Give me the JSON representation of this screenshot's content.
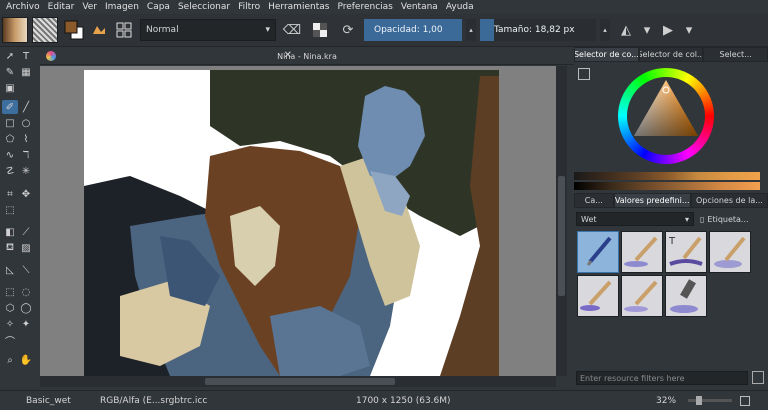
{
  "menu": [
    "Archivo",
    "Editar",
    "Ver",
    "Imagen",
    "Capa",
    "Seleccionar",
    "Filtro",
    "Herramientas",
    "Preferencias",
    "Ventana",
    "Ayuda"
  ],
  "toolbar": {
    "blend_mode": "Normal",
    "opacity_label": "Opacidad:  1,00",
    "opacity_value": 1.0,
    "size_label": "Tamaño:  18,82 px",
    "size_value": 18.82
  },
  "document": {
    "tab_title": "Nina - Nina.kra"
  },
  "color_selector": {
    "tabs": [
      "Selector de co...",
      "Selector de col...",
      "Select..."
    ],
    "current_color": "#8a5a2b"
  },
  "brush_panel": {
    "tabs": [
      "Ca...",
      "Valores predefini...",
      "Opciones de la..."
    ],
    "preset_group": "Wet",
    "tag_label": "Etiqueta...",
    "filter_placeholder": "Enter resource filters here"
  },
  "status": {
    "brush": "Basic_wet",
    "color_space": "RGB/Alfa (E...srgbtrc.icc",
    "dimensions": "1700 x 1250 (63.6M)",
    "zoom": "32%"
  },
  "colors": {
    "accent": "#3d6f9e",
    "panel_bg": "#31363b",
    "canvas_bg": "#808080"
  }
}
